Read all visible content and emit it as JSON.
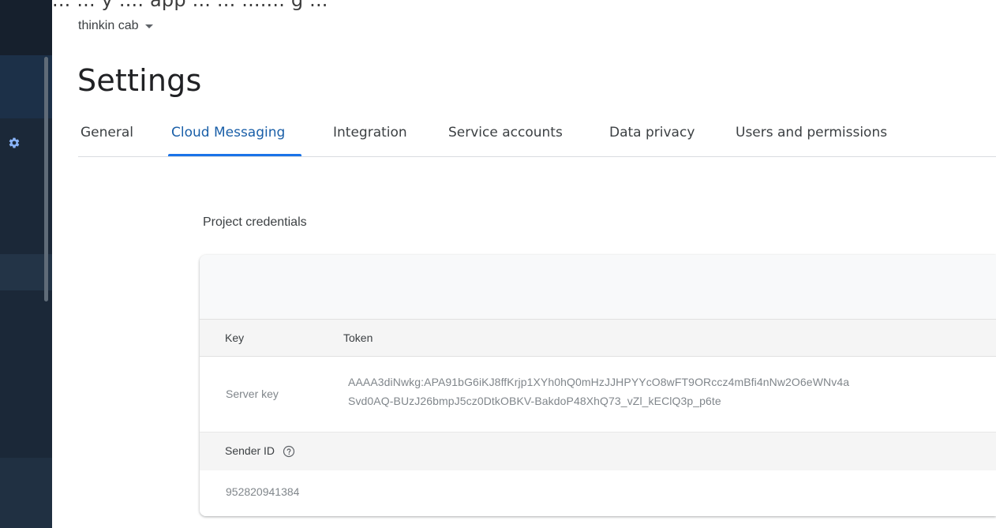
{
  "top_caption": "... ... y .... app ... ... ....... g ...",
  "project": {
    "name": "thinkin cab"
  },
  "page": {
    "title": "Settings"
  },
  "tabs": [
    {
      "label": "General"
    },
    {
      "label": "Cloud Messaging",
      "active": true
    },
    {
      "label": "Integration"
    },
    {
      "label": "Service accounts"
    },
    {
      "label": "Data privacy"
    },
    {
      "label": "Users and permissions"
    }
  ],
  "section": {
    "title": "Project credentials"
  },
  "credentials_table": {
    "headers": {
      "key": "Key",
      "token": "Token"
    },
    "rows": [
      {
        "key": "Server key",
        "token_line1": "AAAA3diNwkg:APA91bG6iKJ8ffKrjp1XYh0hQ0mHzJJHPYYcO8wFT9ORccz4mBfi4nNw2O6eWNv4a",
        "token_line2": "Svd0AQ-BUzJ26bmpJ5cz0DtkOBKV-BakdoP48XhQ73_vZl_kEClQ3p_p6te"
      }
    ],
    "sender": {
      "label": "Sender ID",
      "value": "952820941384"
    }
  },
  "icons": {
    "sidebar": "gear-icon",
    "project_menu": "caret-down-icon",
    "sender_help": "help-icon"
  },
  "colors": {
    "accent": "#1a73e8",
    "sidebar": "#1b2838"
  }
}
